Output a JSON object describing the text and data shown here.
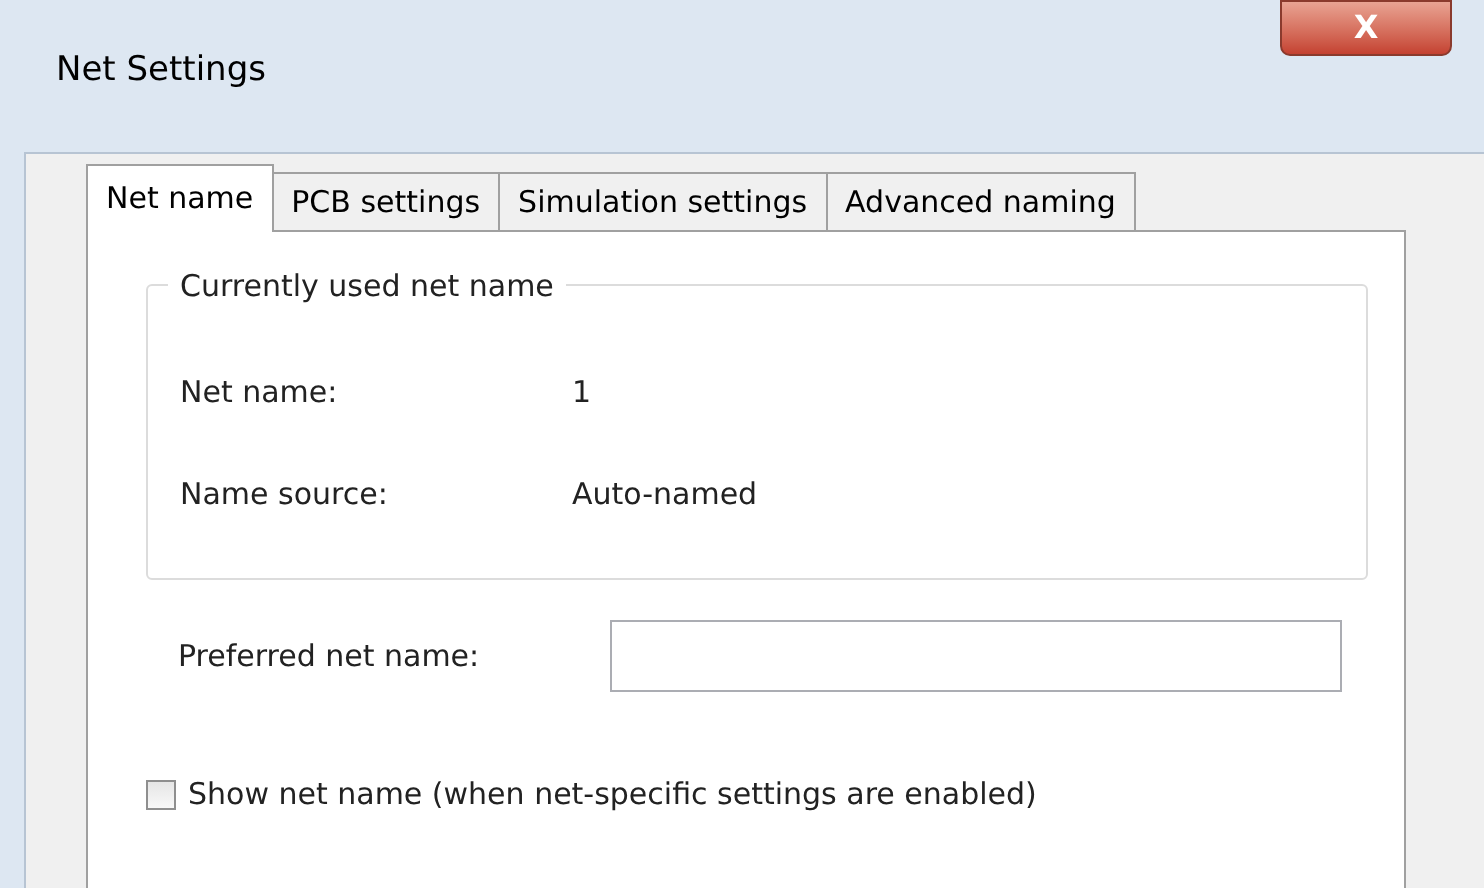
{
  "window": {
    "title": "Net Settings",
    "close": "X"
  },
  "tabs": [
    {
      "label": "Net name",
      "selected": true
    },
    {
      "label": "PCB settings",
      "selected": false
    },
    {
      "label": "Simulation settings",
      "selected": false
    },
    {
      "label": "Advanced naming",
      "selected": false
    }
  ],
  "group": {
    "title": "Currently used net name",
    "rows": [
      {
        "label": "Net name:",
        "value": "1"
      },
      {
        "label": "Name source:",
        "value": "Auto-named"
      }
    ]
  },
  "preferred": {
    "label": "Preferred net name:"
  },
  "show_net_name": {
    "label": "Show net name (when net-specific settings are enabled)",
    "checked": false
  }
}
